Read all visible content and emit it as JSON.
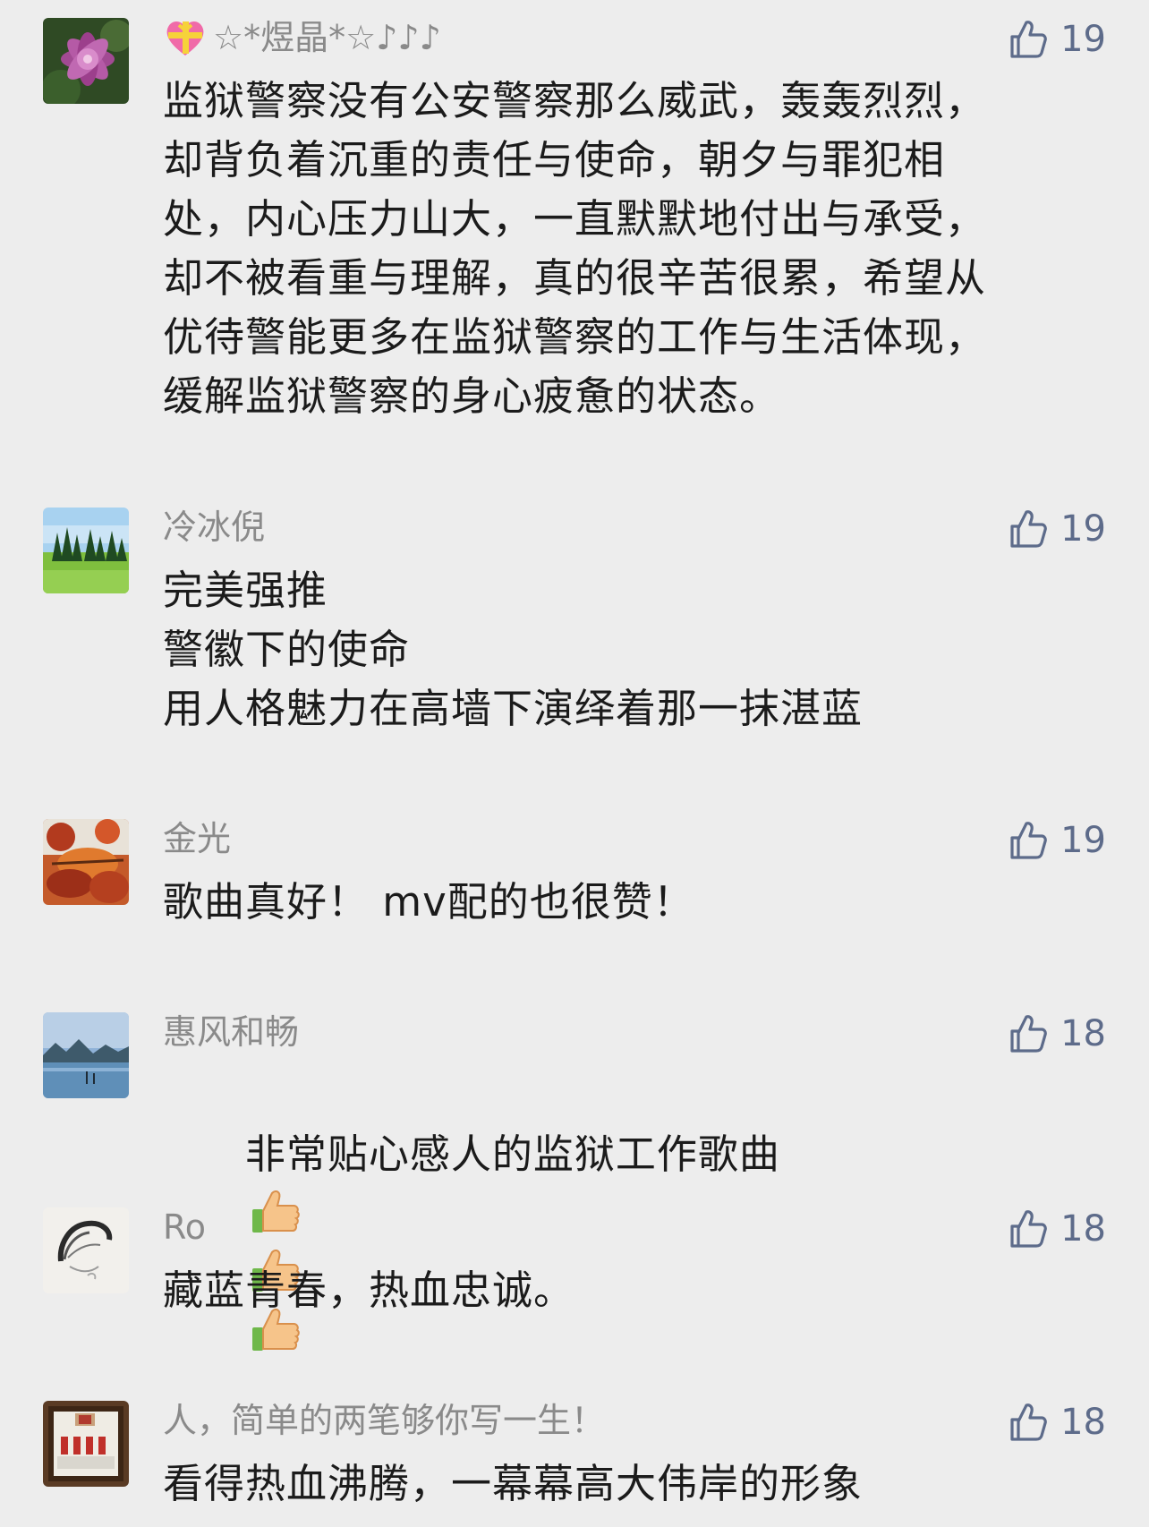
{
  "comments": [
    {
      "name": "☆*煜晶*☆♪♪♪",
      "likes": "19",
      "avatar": "purple-flower",
      "text": "监狱警察没有公安警察那么威武，轰轰烈烈，\n却背负着沉重的责任与使命，朝夕与罪犯相\n处，内心压力山大，一直默默地付出与承受，\n却不被看重与理解，真的很辛苦很累，希望从\n优待警能更多在监狱警察的工作与生活体现，\n缓解监狱警察的身心疲惫的状态。"
    },
    {
      "name": "冷冰倪",
      "likes": "19",
      "avatar": "forest-meadow",
      "text": "完美强推\n警徽下的使命\n用人格魅力在高墙下演绎着那一抹湛蓝"
    },
    {
      "name": "金光",
      "likes": "19",
      "avatar": "autumn-leaves",
      "text": "歌曲真好！ mv配的也很赞！"
    },
    {
      "name": "惠风和畅",
      "likes": "18",
      "avatar": "lake-mountains",
      "text": "非常贴心感人的监狱工作歌曲",
      "emoji_count": 3,
      "emoji": "thumbs-up-icon"
    },
    {
      "name": "Ro",
      "likes": "18",
      "avatar": "sketch-drawing",
      "text": "藏蓝青春，热血忠诚。"
    },
    {
      "name": "人，简单的两笔够你写一生！",
      "likes": "18",
      "avatar": "calligraphy-scroll",
      "text": "看得热血沸腾，一幕幕高大伟岸的形象"
    }
  ],
  "colors": {
    "background": "#ededed",
    "name": "#8a8a8a",
    "like": "#5d6b8a",
    "text": "#1b1b1b"
  }
}
